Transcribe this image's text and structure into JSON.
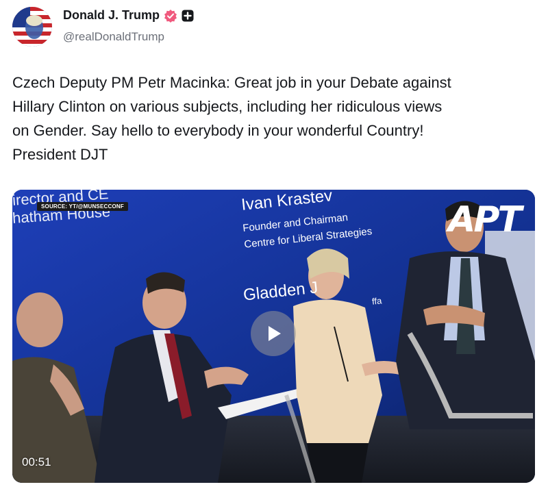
{
  "post": {
    "author": {
      "display_name": "Donald J. Trump",
      "handle": "@realDonaldTrump",
      "verified_icon": "verified-badge-icon",
      "badge_icon": "truth-plus-icon"
    },
    "text_lines": [
      "Czech Deputy PM Petr Macinka: Great job in your Debate against",
      "Hillary Clinton on various subjects, including her ridiculous views",
      "on Gender. Say hello to everybody in your wonderful Country!",
      "President DJT"
    ],
    "media": {
      "source_tag": "SOURCE: YT/@MUNSECCONF",
      "logo": "APT",
      "stage_text": {
        "top_left_1": "irector and CE",
        "top_left_2": "hatham House",
        "name": "Ivan Krastev",
        "role_1": "Founder and Chairman",
        "role_2": "Centre for Liberal Strategies",
        "name_2": "Gladden J",
        "fragment": "ffa"
      },
      "duration": "00:51",
      "play_icon": "play-icon"
    }
  },
  "colors": {
    "verified": "#f05a7e",
    "backdrop": "#1432a8",
    "text": "#16181c",
    "muted": "#6b6f78"
  }
}
